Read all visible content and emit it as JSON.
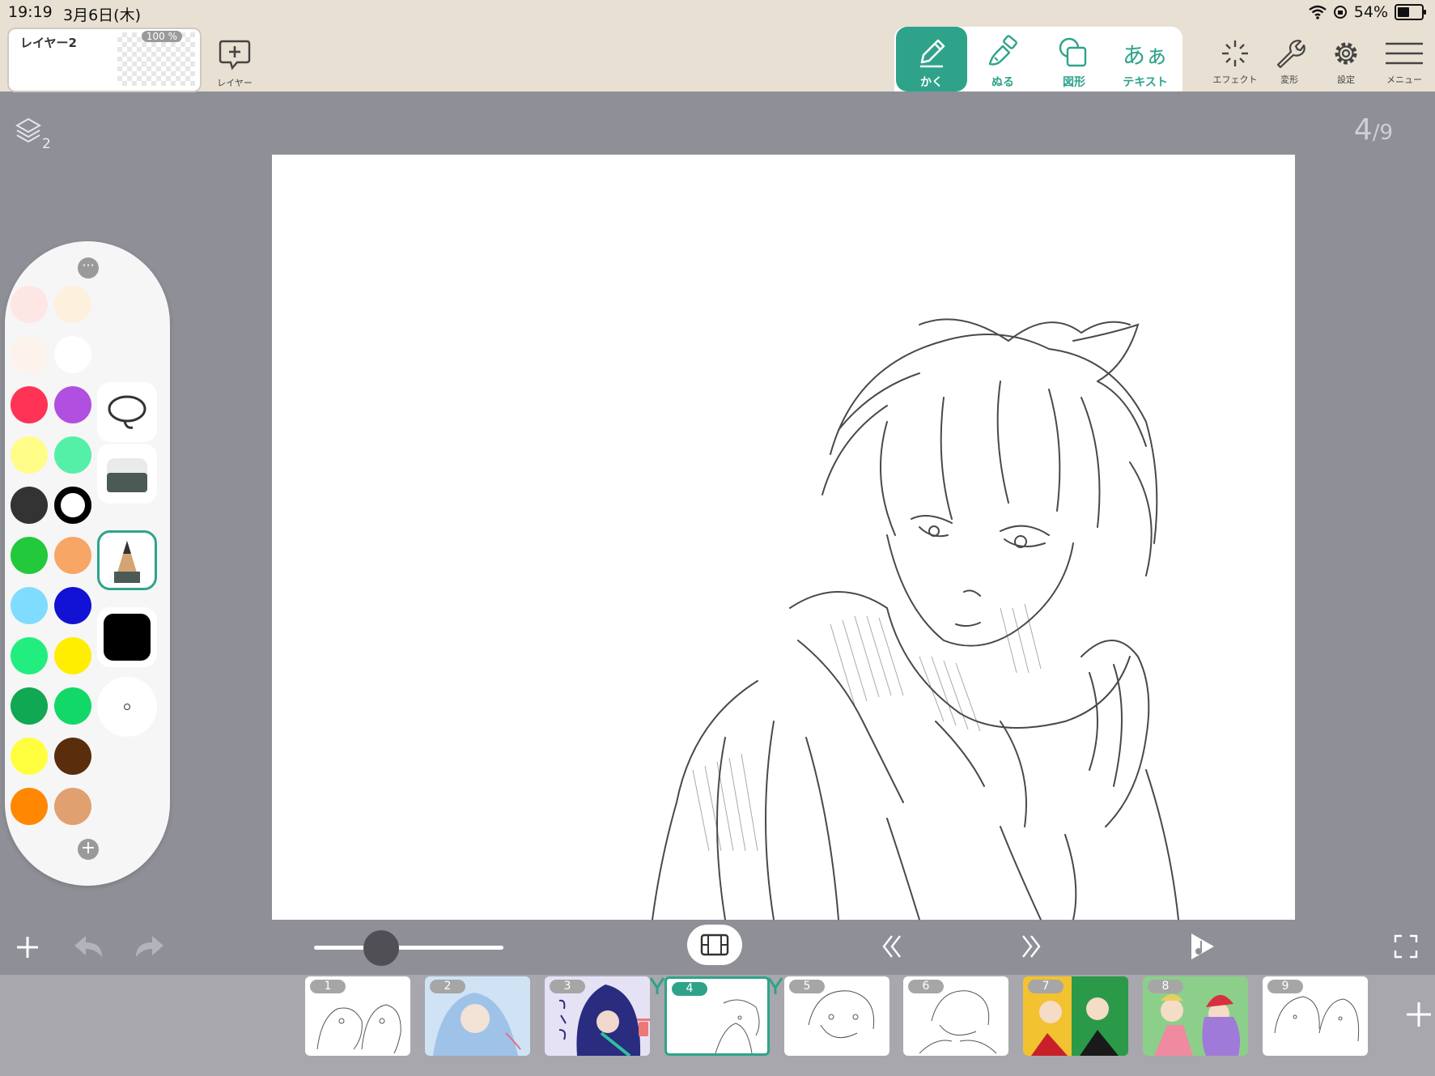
{
  "status_bar": {
    "time": "19:19",
    "date": "3月6日(木)",
    "battery": "54%"
  },
  "layer_panel": {
    "name": "レイヤー2",
    "opacity": "100 %",
    "add_label": "レイヤー"
  },
  "tools": {
    "draw": "かく",
    "fill": "ぬる",
    "shape": "図形",
    "text_icon": "あぁ",
    "text": "テキスト"
  },
  "right_tools": {
    "effect": "エフェクト",
    "transform": "変形",
    "settings": "設定",
    "menu": "メニュー"
  },
  "canvas": {
    "layer_count": "2",
    "page_current": "4",
    "page_total": "9"
  },
  "palette": {
    "colors": [
      "#fde6e4",
      "#fdf0dc",
      "#fdf3ec",
      "#ffffff",
      "#ff3355",
      "#b04fe0",
      "#fffc88",
      "#55f0a8",
      "#333333",
      "#000000",
      "#22c93a",
      "#f7a666",
      "#80dcff",
      "#1212d4",
      "#22ee80",
      "#ffee00",
      "#10a852",
      "#12d868",
      "#ffff40",
      "#5a2d0c",
      "#ff8800",
      "#e0a070"
    ],
    "selected_color": "#000000",
    "accent": "#2fa38a"
  },
  "timeline": {
    "frames": [
      "1",
      "2",
      "3",
      "4",
      "5",
      "6",
      "7",
      "8",
      "9"
    ],
    "active_frame": "4"
  }
}
